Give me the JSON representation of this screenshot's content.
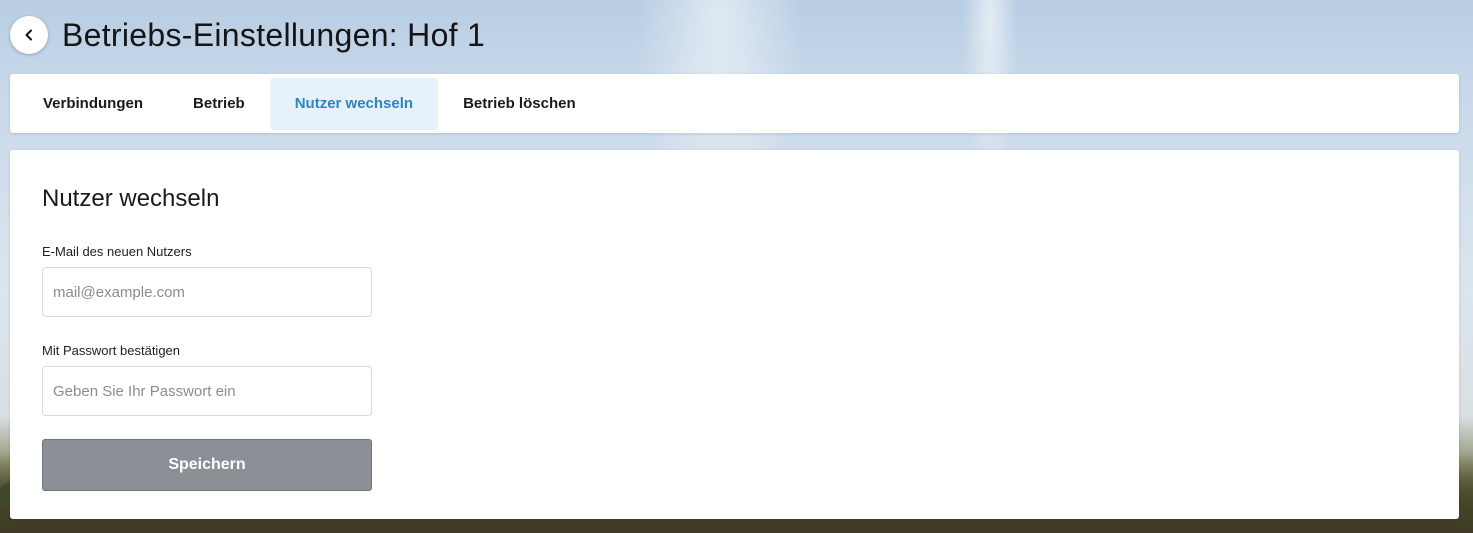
{
  "header": {
    "back_icon": "chevron-left-icon",
    "title": "Betriebs-Einstellungen: Hof 1"
  },
  "tabs": [
    {
      "label": "Verbindungen",
      "active": false
    },
    {
      "label": "Betrieb",
      "active": false
    },
    {
      "label": "Nutzer wechseln",
      "active": true
    },
    {
      "label": "Betrieb löschen",
      "active": false
    }
  ],
  "form": {
    "title": "Nutzer wechseln",
    "email_label": "E-Mail des neuen Nutzers",
    "email_value": "",
    "email_placeholder": "mail@example.com",
    "password_label": "Mit Passwort bestätigen",
    "password_value": "",
    "password_placeholder": "Geben Sie Ihr Passwort ein",
    "save_label": "Speichern"
  },
  "colors": {
    "accent": "#2b86c8",
    "active_tab_bg": "#e6f1fb",
    "button_bg": "#8a9096"
  }
}
